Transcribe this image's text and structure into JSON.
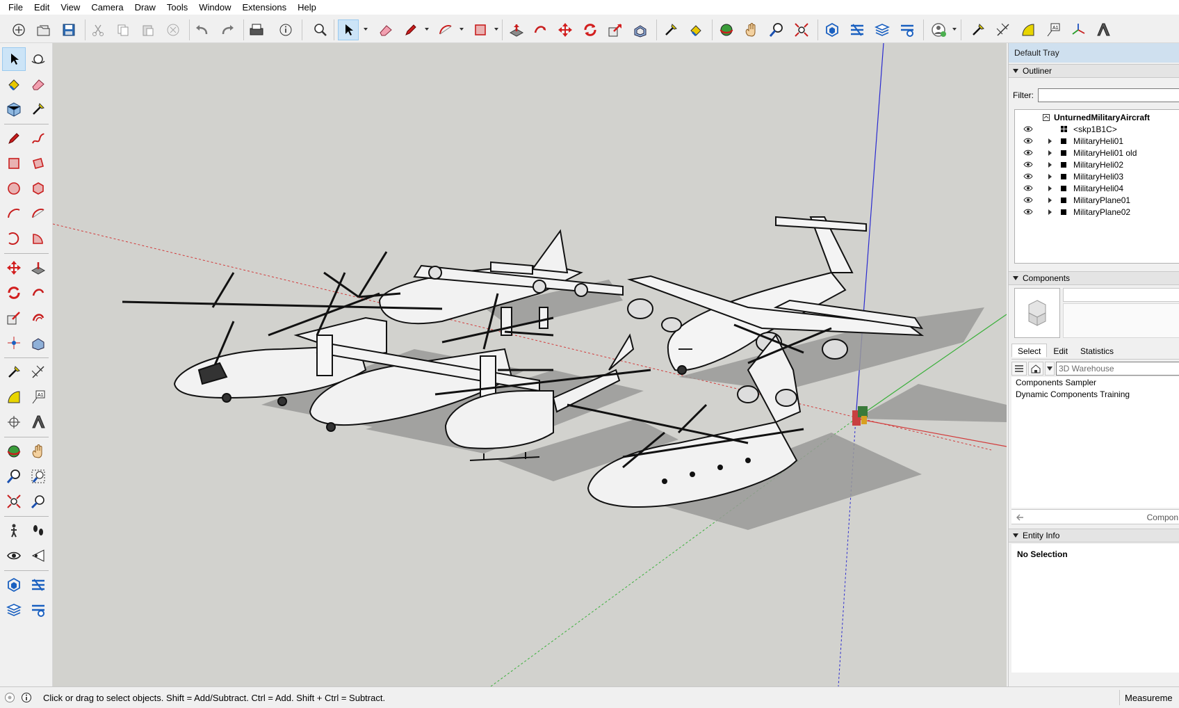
{
  "menubar": {
    "items": [
      "File",
      "Edit",
      "View",
      "Camera",
      "Draw",
      "Tools",
      "Window",
      "Extensions",
      "Help"
    ]
  },
  "toolbar": {
    "icons": [
      "new-icon",
      "open-icon",
      "save-icon",
      "cut-icon",
      "copy-icon",
      "paste-icon",
      "erase-icon",
      "undo-icon",
      "redo-icon",
      "print-icon",
      "model-info-icon",
      "search-icon",
      "select-icon",
      "eraser-icon",
      "pencil-icon",
      "arc-icon",
      "rectangle-icon",
      "push-pull-icon",
      "follow-me-icon",
      "move-icon",
      "rotate-icon",
      "scale-icon",
      "offset-icon",
      "tape-measure-icon",
      "paint-bucket-icon",
      "orbit-icon",
      "pan-icon",
      "zoom-icon",
      "zoom-extents-icon",
      "3d-warehouse-icon",
      "extension-warehouse-icon",
      "layout-icon",
      "extension-manager-icon",
      "account-icon",
      "tape-icon",
      "dimension-icon",
      "protractor-icon",
      "text-icon",
      "axes-icon",
      "3d-text-icon"
    ]
  },
  "left_tools": {
    "icons": [
      "select-icon",
      "orbit-icon",
      "paint-bucket-icon",
      "eraser-icon",
      "component-icon",
      "tape-measure-icon",
      "line-icon",
      "freehand-icon",
      "rectangle-icon",
      "rotated-rectangle-icon",
      "circle-icon",
      "polygon-icon",
      "arc-icon",
      "two-point-arc-icon",
      "three-point-arc-icon",
      "pie-icon",
      "move-icon",
      "push-pull-icon",
      "rotate-icon",
      "follow-me-icon",
      "scale-icon",
      "offset-icon",
      "position-camera-icon",
      "section-plane-icon",
      "tape-icon",
      "dimension-icon",
      "protractor-icon",
      "text-icon",
      "axes-icon",
      "3d-text-icon",
      "orbit-nav-icon",
      "pan-icon",
      "zoom-icon",
      "zoom-window-icon",
      "zoom-extents-icon",
      "previous-view-icon",
      "walk-icon",
      "footprints-icon",
      "look-around-icon",
      "section-icon",
      "warehouse-icon",
      "extension-icon",
      "layout-icon",
      "share-icon"
    ]
  },
  "tray": {
    "title": "Default Tray",
    "outliner": {
      "header": "Outliner",
      "filter_label": "Filter:",
      "filter_value": "",
      "root": "UnturnedMilitaryAircraft",
      "items": [
        {
          "label": "<skp1B1C>",
          "expandable": false
        },
        {
          "label": "MilitaryHeli01",
          "expandable": true
        },
        {
          "label": "MilitaryHeli01 old",
          "expandable": true
        },
        {
          "label": "MilitaryHeli02",
          "expandable": true
        },
        {
          "label": "MilitaryHeli03",
          "expandable": true
        },
        {
          "label": "MilitaryHeli04",
          "expandable": true
        },
        {
          "label": "MilitaryPlane01",
          "expandable": true
        },
        {
          "label": "MilitaryPlane02",
          "expandable": true
        }
      ]
    },
    "components": {
      "header": "Components",
      "tabs": [
        "Select",
        "Edit",
        "Statistics"
      ],
      "active_tab": "Select",
      "search_placeholder": "3D Warehouse",
      "list": [
        "Components Sampler",
        "Dynamic Components Training"
      ],
      "footer_label": "Compon"
    },
    "entity_info": {
      "header": "Entity Info",
      "status": "No Selection"
    }
  },
  "statusbar": {
    "text": "Click or drag to select objects. Shift = Add/Subtract. Ctrl = Add. Shift + Ctrl = Subtract.",
    "measurements_label": "Measureme"
  },
  "colors": {
    "viewport_bg": "#d2d2ce",
    "axis_red": "#d23a3a",
    "axis_green": "#3ab03a",
    "axis_blue": "#2a2ad0",
    "selection_highlight": "#cce4f7"
  }
}
